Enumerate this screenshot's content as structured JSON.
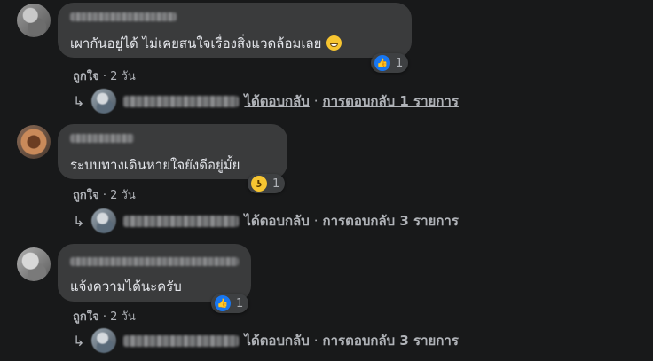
{
  "comments": [
    {
      "text": "เผากันอยู่ได้ ไม่เคยสนใจเรื่องสิ่งแวดล้อมเลย",
      "emoji": "grinning-sweat-emoji",
      "reaction": {
        "type": "like-icon",
        "count": "1"
      },
      "like_label": "ถูกใจ",
      "separator": "·",
      "time": "2 วัน",
      "replied_label": "ได้ตอบกลับ",
      "replies_label": "การตอบกลับ 1 รายการ"
    },
    {
      "text": "ระบบทางเดินหายใจยังดีอยู่มั้ย",
      "reaction": {
        "type": "haha-icon",
        "count": "1"
      },
      "like_label": "ถูกใจ",
      "separator": "·",
      "time": "2 วัน",
      "replied_label": "ได้ตอบกลับ",
      "replies_label": "การตอบกลับ 3 รายการ"
    },
    {
      "text": "แจ้งความได้นะครับ",
      "reaction": {
        "type": "like-icon",
        "count": "1"
      },
      "like_label": "ถูกใจ",
      "separator": "·",
      "time": "2 วัน",
      "replied_label": "ได้ตอบกลับ",
      "replies_label": "การตอบกลับ 3 รายการ"
    }
  ],
  "colors": {
    "background": "#18191a",
    "bubble": "#3a3b3c",
    "text_primary": "#e4e6eb",
    "text_secondary": "#b0b3b8",
    "like_blue": "#1877f2",
    "haha_yellow": "#f7c531"
  }
}
